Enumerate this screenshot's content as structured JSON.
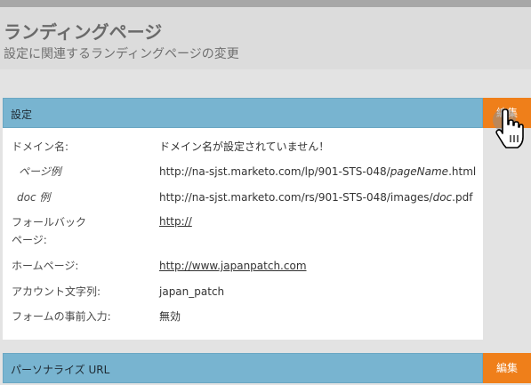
{
  "header": {
    "title": "ランディングページ",
    "subtitle": "設定に関連するランディングページの変更"
  },
  "settings": {
    "title": "設定",
    "edit_label": "編集",
    "rows": [
      {
        "key": "ドメイン名:",
        "value": "ドメイン名が設定されていません！"
      },
      {
        "key": "ページ例",
        "value_prefix": "http://na-sjst.marketo.com/lp/901-STS-048/",
        "value_italic": "pageName",
        "value_suffix": ".html"
      },
      {
        "key": "doc 例",
        "value_prefix": "http://na-sjst.marketo.com/rs/901-STS-048/images/",
        "value_italic": "doc",
        "value_suffix": ".pdf"
      },
      {
        "key": "フォールバック\nページ:",
        "value": "http://"
      },
      {
        "key": "ホームページ:",
        "value": "http://www.japanpatch.com"
      },
      {
        "key": "アカウント文字列:",
        "value": "japan_patch"
      },
      {
        "key": "フォームの事前入力:",
        "value": "無効"
      }
    ]
  },
  "personalize": {
    "title": "パーソナライズ URL",
    "edit_label": "編集"
  },
  "icons": {
    "cursor": "hand-pointer-icon"
  },
  "colors": {
    "section_header": "#78b4d0",
    "edit_button": "#ef7f1a"
  }
}
